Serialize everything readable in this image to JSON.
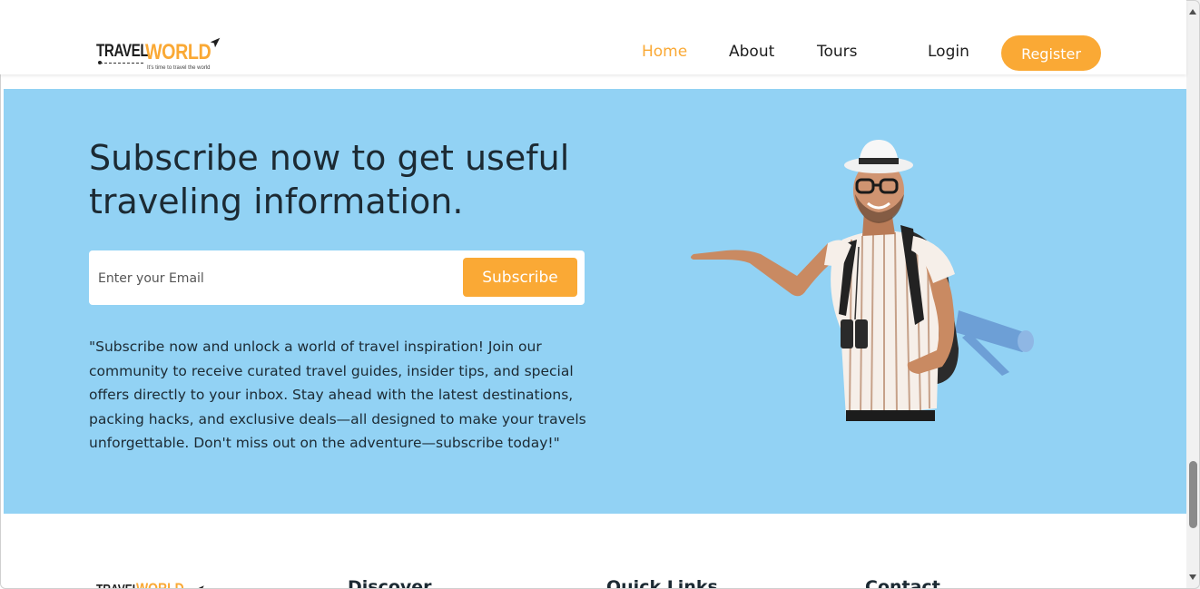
{
  "brand": {
    "name_part1": "TRAVEL",
    "name_part2": "WORLD",
    "tagline": "It's time to travel the world"
  },
  "nav": {
    "items": [
      {
        "label": "Home",
        "active": true
      },
      {
        "label": "About",
        "active": false
      },
      {
        "label": "Tours",
        "active": false
      }
    ],
    "login_label": "Login",
    "register_label": "Register"
  },
  "newsletter": {
    "title": "Subscribe now to get useful traveling information.",
    "email_placeholder": "Enter your Email",
    "email_value": "",
    "subscribe_label": "Subscribe",
    "description": "\"Subscribe now and unlock a world of travel inspiration! Join our community to receive curated travel guides, insider tips, and special offers directly to your inbox. Stay ahead with the latest destinations, packing hacks, and exclusive deals—all designed to make your travels unforgettable. Don't miss out on the adventure—subscribe today!\""
  },
  "footer": {
    "headings": [
      "Discover",
      "Quick Links",
      "Contact"
    ]
  },
  "icons": {
    "plane": "plane-icon",
    "traveler": "traveler-illustration"
  },
  "colors": {
    "accent": "#faa935",
    "newsletter_bg": "#92d2f4",
    "text_dark": "#1c2a33"
  }
}
